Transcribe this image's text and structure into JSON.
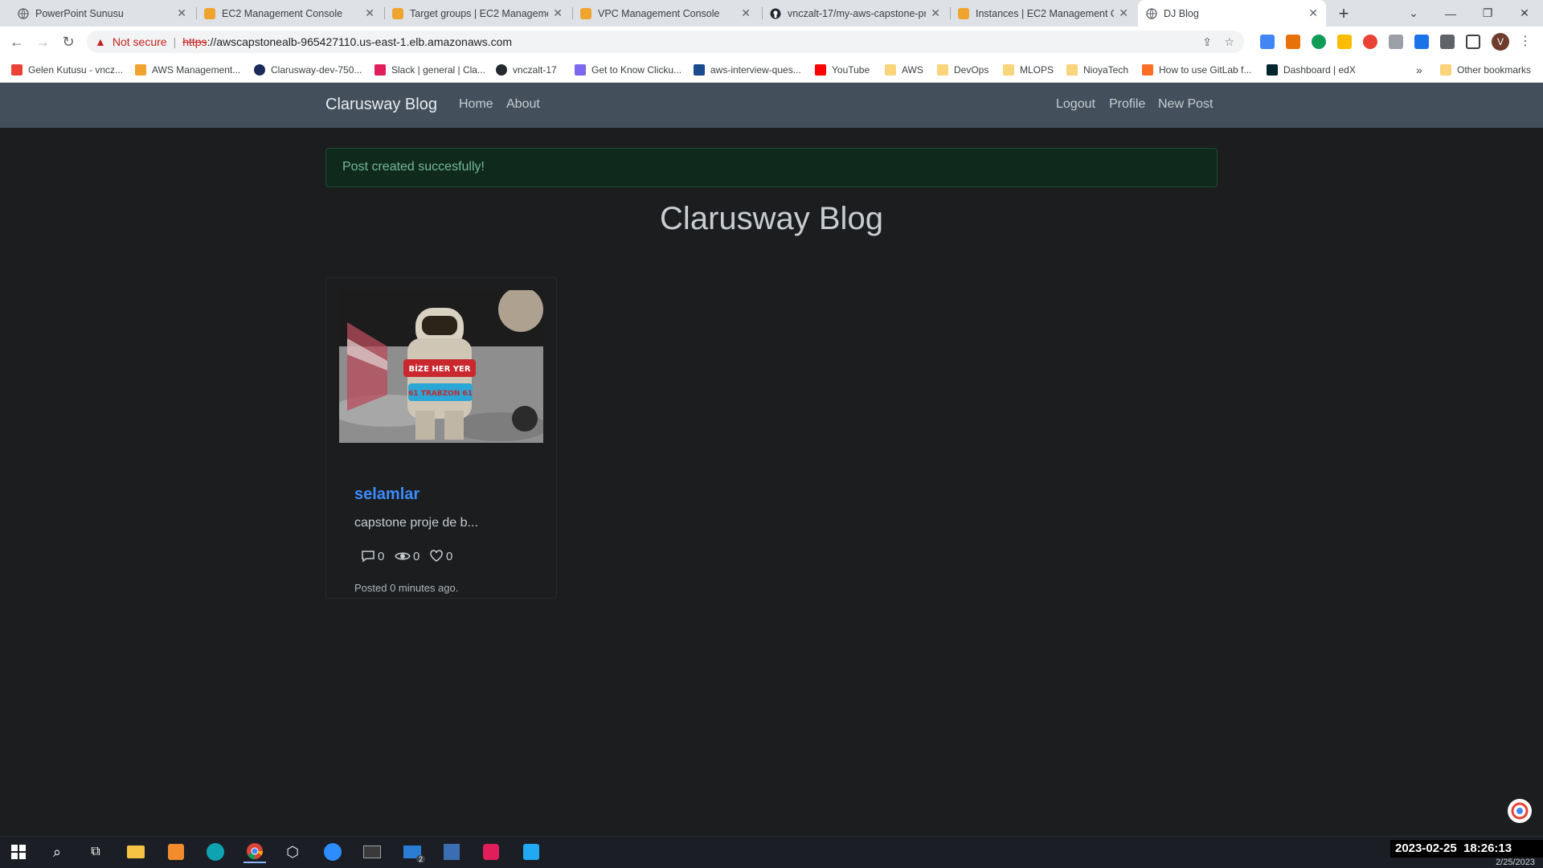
{
  "browser": {
    "tabs": [
      {
        "title": "PowerPoint Sunusu"
      },
      {
        "title": "EC2 Management Console"
      },
      {
        "title": "Target groups | EC2 Managemen"
      },
      {
        "title": "VPC Management Console"
      },
      {
        "title": "vnczalt-17/my-aws-capstone-pr"
      },
      {
        "title": "Instances | EC2 Management Co"
      },
      {
        "title": "DJ Blog"
      }
    ],
    "new_tab_label": "+",
    "security_label": "Not secure",
    "url_scheme": "https",
    "url_rest": "://awscapstonealb-965427110.us-east-1.elb.amazonaws.com",
    "profile_initial": "V",
    "bookmarks": [
      {
        "label": "Gelen Kutusu - vncz..."
      },
      {
        "label": "AWS Management..."
      },
      {
        "label": "Clarusway-dev-750..."
      },
      {
        "label": "Slack | general | Cla..."
      },
      {
        "label": "vnczalt-17"
      },
      {
        "label": "Get to Know Clicku..."
      },
      {
        "label": "aws-interview-ques..."
      },
      {
        "label": "YouTube"
      },
      {
        "label": "AWS"
      },
      {
        "label": "DevOps"
      },
      {
        "label": "MLOPS"
      },
      {
        "label": "NioyaTech"
      },
      {
        "label": "How to use GitLab f..."
      },
      {
        "label": "Dashboard | edX"
      }
    ],
    "overflow_label": "»",
    "other_bookmarks_label": "Other bookmarks"
  },
  "navbar": {
    "brand": "Clarusway Blog",
    "left_links": [
      "Home",
      "About"
    ],
    "right_links": [
      "Logout",
      "Profile",
      "New Post"
    ]
  },
  "alert": {
    "message": "Post created succesfully!"
  },
  "page": {
    "heading": "Clarusway Blog"
  },
  "post": {
    "title": "selamlar",
    "excerpt": "capstone proje de b...",
    "comments": "0",
    "views": "0",
    "likes": "0",
    "posted": "Posted 0 minutes ago.",
    "image_banner_lines": [
      "BİZE HER YER",
      "61 TRABZON 61"
    ]
  },
  "taskbar": {
    "mail_badge": "2",
    "clock_datetime": "2023-02-25  18:26:13",
    "clock_date_small": "2/25/2023"
  },
  "colors": {
    "page_bg": "#1b1d1f",
    "navbar_bg": "#43505c",
    "alert_bg": "#0f2a1c",
    "alert_text": "#75b798",
    "link_blue": "#3d8bfd"
  }
}
